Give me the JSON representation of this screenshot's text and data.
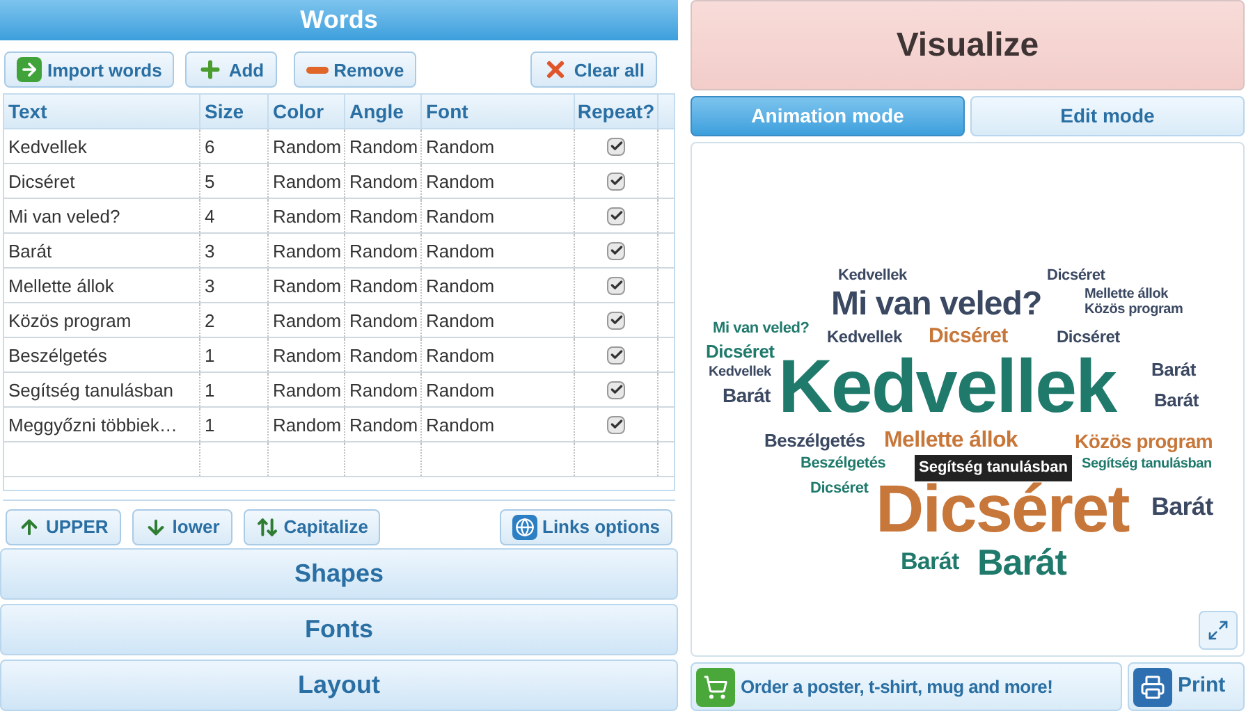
{
  "words_panel": {
    "title": "Words",
    "toolbar": [
      {
        "kind": "import",
        "label": "Import words"
      },
      {
        "kind": "add",
        "label": "Add"
      },
      {
        "kind": "remove",
        "label": "Remove"
      },
      {
        "kind": "clear",
        "label": "Clear all"
      }
    ],
    "table": {
      "columns": [
        "Text",
        "Size",
        "Color",
        "Angle",
        "Font",
        "Repeat?"
      ],
      "rows": [
        {
          "text": "Kedvellek",
          "size": "6",
          "color_setting": "Random",
          "angle": "Random",
          "font": "Random",
          "repeat": true
        },
        {
          "text": "Dicséret",
          "size": "5",
          "color_setting": "Random",
          "angle": "Random",
          "font": "Random",
          "repeat": true
        },
        {
          "text": "Mi van veled?",
          "size": "4",
          "color_setting": "Random",
          "angle": "Random",
          "font": "Random",
          "repeat": true
        },
        {
          "text": "Barát",
          "size": "3",
          "color_setting": "Random",
          "angle": "Random",
          "font": "Random",
          "repeat": true
        },
        {
          "text": "Mellette állok",
          "size": "3",
          "color_setting": "Random",
          "angle": "Random",
          "font": "Random",
          "repeat": true
        },
        {
          "text": "Közös program",
          "size": "2",
          "color_setting": "Random",
          "angle": "Random",
          "font": "Random",
          "repeat": true
        },
        {
          "text": "Beszélgetés",
          "size": "1",
          "color_setting": "Random",
          "angle": "Random",
          "font": "Random",
          "repeat": true
        },
        {
          "text": "Segítség tanulásban",
          "size": "1",
          "color_setting": "Random",
          "angle": "Random",
          "font": "Random",
          "repeat": true
        },
        {
          "text": "Meggyőzni többiek…",
          "size": "1",
          "color_setting": "Random",
          "angle": "Random",
          "font": "Random",
          "repeat": true
        }
      ]
    },
    "case_toolbar": [
      {
        "kind": "upper",
        "label": "UPPER"
      },
      {
        "kind": "lower",
        "label": "lower"
      },
      {
        "kind": "capitalize",
        "label": "Capitalize"
      },
      {
        "kind": "links",
        "label": "Links options"
      }
    ],
    "sections": [
      "Shapes",
      "Fonts",
      "Layout"
    ]
  },
  "visualize": {
    "title": "Visualize",
    "tabs": [
      {
        "label": "Animation mode",
        "selected": true
      },
      {
        "label": "Edit mode",
        "selected": false
      }
    ],
    "cloud_words": [
      {
        "text": "Kedvellek",
        "color": "#3b4862"
      },
      {
        "text": "Dicséret",
        "color": "#3b4862"
      },
      {
        "text": "Mi van veled?",
        "color": "#3b4862"
      },
      {
        "text": "Mellette állok",
        "color": "#3b4862"
      },
      {
        "text": "Közös program",
        "color": "#3b4862"
      },
      {
        "text": "Mi van veled?",
        "color": "#1f7a6c"
      },
      {
        "text": "Kedvellek",
        "color": "#3b4862"
      },
      {
        "text": "Dicséret",
        "color": "#c8773a"
      },
      {
        "text": "Dicséret",
        "color": "#3b4862"
      },
      {
        "text": "Dicséret",
        "color": "#1f7a6c"
      },
      {
        "text": "Kedvellek",
        "color": "#3b4862"
      },
      {
        "text": "Barát",
        "color": "#3b4862"
      },
      {
        "text": "Kedvellek",
        "color": "#1f7a6c"
      },
      {
        "text": "Barát",
        "color": "#3b4862"
      },
      {
        "text": "Barát",
        "color": "#3b4862"
      },
      {
        "text": "Beszélgetés",
        "color": "#3b4862"
      },
      {
        "text": "Mellette állok",
        "color": "#c8773a"
      },
      {
        "text": "Közös program",
        "color": "#c8773a"
      },
      {
        "text": "Beszélgetés",
        "color": "#1f7a6c"
      },
      {
        "text": "Segítség tanulásban",
        "color": "#1f7a6c"
      },
      {
        "text": "Dicséret",
        "color": "#1f7a6c"
      },
      {
        "text": "Dicséret",
        "color": "#c8773a"
      },
      {
        "text": "Barát",
        "color": "#3b4862"
      },
      {
        "text": "Barát",
        "color": "#1f7a6c"
      },
      {
        "text": "Barát",
        "color": "#1f7a6c"
      }
    ],
    "tooltip": "Segítség tanulásban",
    "actions": [
      {
        "kind": "order",
        "label": "Order a poster, t-shirt, mug and more!"
      },
      {
        "kind": "print",
        "label": "Print"
      }
    ]
  }
}
